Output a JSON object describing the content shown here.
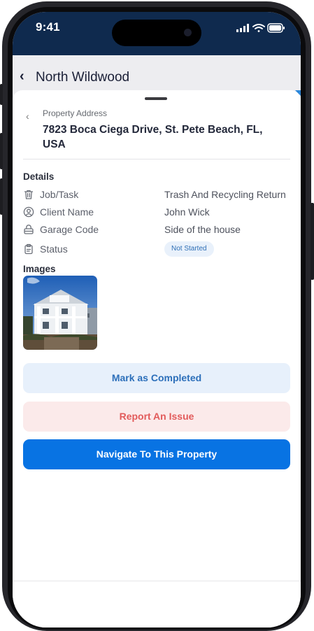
{
  "status_bar": {
    "time": "9:41"
  },
  "header": {
    "back_icon": "‹",
    "title": "North Wildwood"
  },
  "property": {
    "label": "Property Address",
    "address": "7823 Boca Ciega Drive, St. Pete Beach, FL, USA",
    "back_icon": "‹"
  },
  "details": {
    "title": "Details",
    "rows": [
      {
        "icon": "trash-icon",
        "label": "Job/Task",
        "value": "Trash And Recycling Return"
      },
      {
        "icon": "user-icon",
        "label": "Client Name",
        "value": "John Wick"
      },
      {
        "icon": "lock-icon",
        "label": "Garage Code",
        "value": "Side of the house"
      },
      {
        "icon": "clipboard-icon",
        "label": "Status",
        "value": "Not Started"
      }
    ]
  },
  "images": {
    "title": "Images"
  },
  "actions": {
    "complete_label": "Mark as Completed",
    "report_label": "Report An Issue",
    "navigate_label": "Navigate To This Property"
  },
  "colors": {
    "status_bar": "#0f2a4e",
    "primary": "#0873e3",
    "complete_bg": "#e7f0fb",
    "report_bg": "#fbeaea",
    "report_text": "#e25b5b",
    "badge_bg": "#e9f1fb"
  }
}
